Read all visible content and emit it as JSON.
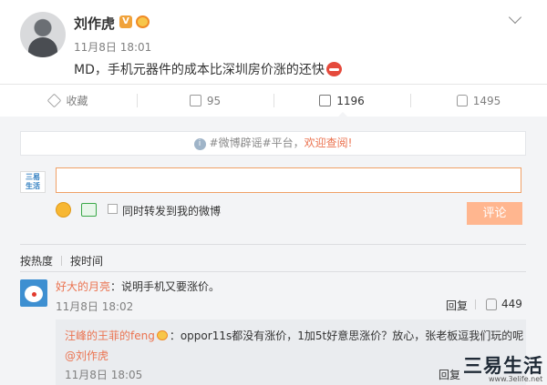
{
  "post": {
    "author": "刘作虎",
    "verified_badge": "V",
    "time": "11月8日 18:01",
    "text": "MD，手机元器件的成本比深圳房价涨的还快"
  },
  "actions": [
    {
      "icon": "star-icon",
      "label": "收藏"
    },
    {
      "icon": "share-icon",
      "label": "95"
    },
    {
      "icon": "comment-icon",
      "label": "1196"
    },
    {
      "icon": "thumbs-up-icon",
      "label": "1495"
    }
  ],
  "notice": {
    "prefix": "#微博辟谣#平台，",
    "link": "欢迎查阅!"
  },
  "comment_box": {
    "logo_top": "三易",
    "logo_bottom": "生活",
    "value": "",
    "forward_label": "同时转发到我的微博",
    "submit_label": "评论"
  },
  "sort": {
    "by_hot": "按热度",
    "by_time": "按时间"
  },
  "comment": {
    "name": "好大的月亮",
    "text": "：说明手机又要涨价。",
    "time": "11月8日 18:02",
    "reply": "回复",
    "likes": "449"
  },
  "subcomment": {
    "name": "汪峰的王菲的feng",
    "text": "：oppor11s都没有涨价，1加5t好意思涨价？放心，张老板逗我们玩的呢",
    "mention": "@刘作虎",
    "time": "11月8日 18:05",
    "reply": "回复"
  },
  "watermark": {
    "main": "三易生活",
    "sub": "www.3elife.net"
  },
  "colors": {
    "accent": "#eb7350",
    "submit_disabled": "#ffb68f",
    "panel_bg": "#f3f4f6"
  }
}
